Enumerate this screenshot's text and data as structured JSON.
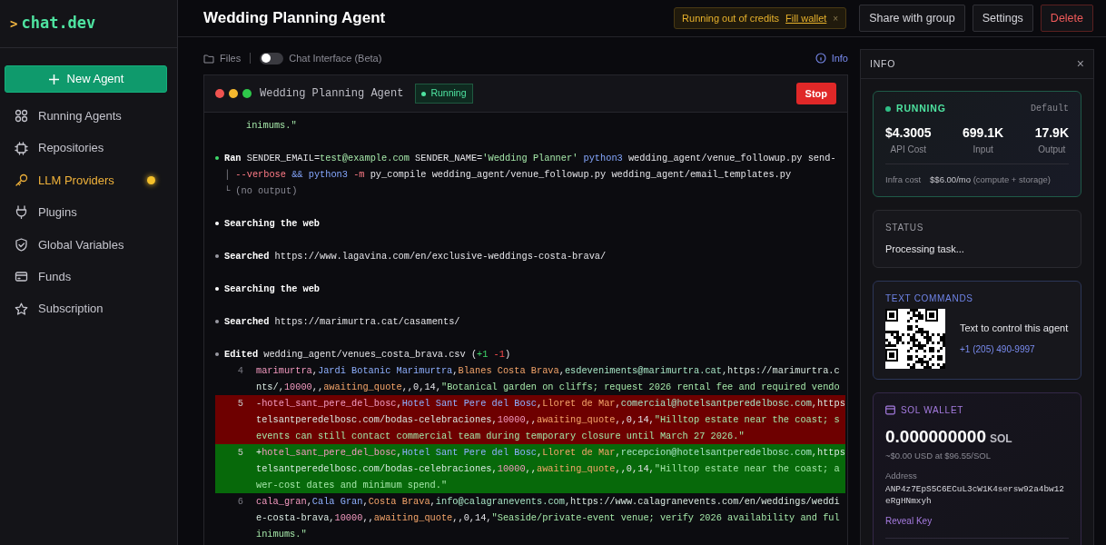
{
  "sidebar": {
    "logo_prompt": ">",
    "logo_text": "chat.dev",
    "new_button": "New Agent",
    "items": [
      {
        "label": "Running Agents",
        "alert": false
      },
      {
        "label": "Repositories",
        "alert": false
      },
      {
        "label": "LLM Providers",
        "alert": true
      },
      {
        "label": "Plugins",
        "alert": false
      },
      {
        "label": "Global Variables",
        "alert": false
      },
      {
        "label": "Funds",
        "alert": false
      },
      {
        "label": "Subscription",
        "alert": false
      }
    ]
  },
  "header": {
    "title": "Wedding Planning Agent",
    "notice": {
      "text": "Running out of credits",
      "link": "Fill wallet",
      "close": "×"
    },
    "buttons": [
      {
        "label": "Share with group",
        "kind": "default"
      },
      {
        "label": "Settings",
        "kind": "default"
      },
      {
        "label": "Delete",
        "kind": "danger"
      }
    ]
  },
  "toolbar": {
    "files": "Files",
    "chat_toggle": {
      "label": "Chat Interface (Beta)",
      "on": false
    },
    "info": "Info"
  },
  "terminal": {
    "title": "Wedding Planning Agent",
    "status": "Running",
    "stop": "Stop",
    "blocks": [
      {
        "kind": "tail",
        "lines": [
          [
            {
              "text": "inimums.\"",
              "kind": "string"
            }
          ]
        ]
      },
      {
        "kind": "step",
        "color": "#3fd96a",
        "lines": [
          [
            {
              "text": "Ran",
              "kind": "bold"
            },
            {
              "text": " SENDER_EMAIL=",
              "kind": "plain"
            },
            {
              "text": "test@example.com",
              "kind": "string"
            },
            {
              "text": " SENDER_NAME=",
              "kind": "plain"
            },
            {
              "text": "'Wedding Planner'",
              "kind": "string"
            },
            {
              "text": " python3",
              "kind": "keyword"
            },
            {
              "text": " wedding_agent/venue_followup.py send-",
              "kind": "plain"
            }
          ],
          [
            {
              "text": "│ ",
              "kind": "muted"
            },
            {
              "text": "--verbose",
              "kind": "flag"
            },
            {
              "text": " && ",
              "kind": "keyword"
            },
            {
              "text": "python3",
              "kind": "keyword"
            },
            {
              "text": " -m",
              "kind": "flag"
            },
            {
              "text": " py_compile wedding_agent/venue_followup.py wedding_agent/email_templates.py",
              "kind": "plain"
            }
          ],
          [
            {
              "text": "└ (no output)",
              "kind": "muted"
            }
          ]
        ]
      },
      {
        "kind": "step",
        "color": "#ffffff",
        "lines": [
          [
            {
              "text": "Searching the web",
              "kind": "bold"
            }
          ]
        ]
      },
      {
        "kind": "step",
        "color": "#9a9aa2",
        "lines": [
          [
            {
              "text": "Searched",
              "kind": "bold"
            },
            {
              "text": " https://www.lagavina.com/en/exclusive-weddings-costa-brava/",
              "kind": "plain"
            }
          ]
        ]
      },
      {
        "kind": "step",
        "color": "#ffffff",
        "lines": [
          [
            {
              "text": "Searching the web",
              "kind": "bold"
            }
          ]
        ]
      },
      {
        "kind": "step",
        "color": "#9a9aa2",
        "lines": [
          [
            {
              "text": "Searched",
              "kind": "bold"
            },
            {
              "text": " https://marimurtra.cat/casaments/",
              "kind": "plain"
            }
          ]
        ]
      },
      {
        "kind": "edit",
        "color": "#9a9aa2",
        "lines": [
          [
            {
              "text": "Edited",
              "kind": "bold"
            },
            {
              "text": " wedding_agent/venues_costa_brava.csv (",
              "kind": "plain"
            },
            {
              "text": "+1",
              "kind": "add"
            },
            {
              "text": " -1",
              "kind": "del"
            },
            {
              "text": ")",
              "kind": "plain"
            }
          ]
        ],
        "diff": [
          {
            "number": "4",
            "kind": "context",
            "lines": [
              [
                {
                  "text": "marimurtra",
                  "kind": "id"
                },
                {
                  "text": ",",
                  "kind": "plain"
                },
                {
                  "text": "Jardi Botanic Marimurtra",
                  "kind": "name"
                },
                {
                  "text": ",",
                  "kind": "plain"
                },
                {
                  "text": "Blanes Costa Brava",
                  "kind": "place"
                },
                {
                  "text": ",",
                  "kind": "plain"
                },
                {
                  "text": "esdeveniments@marimurtra.cat",
                  "kind": "email"
                },
                {
                  "text": ",https://marimurtra.c",
                  "kind": "url"
                }
              ],
              [
                {
                  "text": "nts/,",
                  "kind": "url"
                },
                {
                  "text": "10000",
                  "kind": "number"
                },
                {
                  "text": ",,",
                  "kind": "plain"
                },
                {
                  "text": "awaiting_quote",
                  "kind": "place"
                },
                {
                  "text": ",,0,14,",
                  "kind": "plain"
                },
                {
                  "text": "\"Botanical garden on cliffs; request 2026 rental fee and required vendo",
                  "kind": "string"
                }
              ]
            ]
          },
          {
            "number": "5",
            "kind": "removed",
            "sign": "-",
            "lines": [
              [
                {
                  "text": "hotel_sant_pere_del_bosc",
                  "kind": "id"
                },
                {
                  "text": ",",
                  "kind": "plain"
                },
                {
                  "text": "Hotel Sant Pere del Bosc",
                  "kind": "name"
                },
                {
                  "text": ",",
                  "kind": "plain"
                },
                {
                  "text": "Lloret de Mar",
                  "kind": "place"
                },
                {
                  "text": ",",
                  "kind": "plain"
                },
                {
                  "text": "comercial@hotelsantperedelbosc.com",
                  "kind": "email"
                },
                {
                  "text": ",https",
                  "kind": "url"
                }
              ],
              [
                {
                  "text": "telsantperedelbosc.com/bodas-celebraciones,",
                  "kind": "url"
                },
                {
                  "text": "10000",
                  "kind": "number"
                },
                {
                  "text": ",,",
                  "kind": "plain"
                },
                {
                  "text": "awaiting_quote",
                  "kind": "place"
                },
                {
                  "text": ",,0,14,",
                  "kind": "plain"
                },
                {
                  "text": "\"Hilltop estate near the coast; s",
                  "kind": "string"
                }
              ],
              [
                {
                  "text": "events can still contact commercial team during temporary closure until March 27 2026.\"",
                  "kind": "string"
                }
              ]
            ]
          },
          {
            "number": "5",
            "kind": "added",
            "sign": "+",
            "lines": [
              [
                {
                  "text": "hotel_sant_pere_del_bosc",
                  "kind": "id"
                },
                {
                  "text": ",",
                  "kind": "plain"
                },
                {
                  "text": "Hotel Sant Pere del Bosc",
                  "kind": "name"
                },
                {
                  "text": ",",
                  "kind": "plain"
                },
                {
                  "text": "Lloret de Mar",
                  "kind": "place"
                },
                {
                  "text": ",",
                  "kind": "plain"
                },
                {
                  "text": "recepcion@hotelsantperedelbosc.com",
                  "kind": "email"
                },
                {
                  "text": ",https",
                  "kind": "url"
                }
              ],
              [
                {
                  "text": "telsantperedelbosc.com/bodas-celebraciones,",
                  "kind": "url"
                },
                {
                  "text": "10000",
                  "kind": "number"
                },
                {
                  "text": ",,",
                  "kind": "plain"
                },
                {
                  "text": "awaiting_quote",
                  "kind": "place"
                },
                {
                  "text": ",,0,14,",
                  "kind": "plain"
                },
                {
                  "text": "\"Hilltop estate near the coast; a",
                  "kind": "string"
                }
              ],
              [
                {
                  "text": "wer-cost dates and minimum spend.\"",
                  "kind": "string"
                }
              ]
            ]
          },
          {
            "number": "6",
            "kind": "context",
            "lines": [
              [
                {
                  "text": "cala_gran",
                  "kind": "id"
                },
                {
                  "text": ",",
                  "kind": "plain"
                },
                {
                  "text": "Cala Gran",
                  "kind": "name"
                },
                {
                  "text": ",",
                  "kind": "plain"
                },
                {
                  "text": "Costa Brava",
                  "kind": "place"
                },
                {
                  "text": ",",
                  "kind": "plain"
                },
                {
                  "text": "info@calagranevents.com",
                  "kind": "email"
                },
                {
                  "text": ",https://www.calagranevents.com/en/weddings/weddi",
                  "kind": "url"
                }
              ],
              [
                {
                  "text": "e-costa-brava,",
                  "kind": "url"
                },
                {
                  "text": "10000",
                  "kind": "number"
                },
                {
                  "text": ",,",
                  "kind": "plain"
                },
                {
                  "text": "awaiting_quote",
                  "kind": "place"
                },
                {
                  "text": ",,0,14,",
                  "kind": "plain"
                },
                {
                  "text": "\"Seaside/private-event venue; verify 2026 availability and ful",
                  "kind": "string"
                }
              ],
              [
                {
                  "text": "inimums.\"",
                  "kind": "string"
                }
              ]
            ]
          }
        ]
      }
    ]
  },
  "info_panel": {
    "title": "INFO",
    "close": "×",
    "summary": {
      "state": "RUNNING",
      "tier": "Default",
      "stats": [
        {
          "value": "$4.3005",
          "label": "API Cost"
        },
        {
          "value": "699.1K",
          "label": "Input"
        },
        {
          "value": "17.9K",
          "label": "Output"
        }
      ],
      "infra_label": "Infra cost",
      "infra_value": "$$6.00/mo",
      "infra_note": "(compute + storage)"
    },
    "status": {
      "label": "STATUS",
      "text": "Processing task..."
    },
    "text_commands": {
      "title": "TEXT COMMANDS",
      "text": "Text to control this agent",
      "phone": "+1 (205) 490-9997"
    },
    "wallet": {
      "title": "SOL WALLET",
      "amount": "0.000000000",
      "unit": "SOL",
      "usd": "~$0.00 USD at $96.55/SOL",
      "address_label": "Address",
      "address": "ANP4z7EpS5C6ECuL3cW1K4sersw92a4bw12eRgHNmxyh",
      "reveal": "Reveal Key"
    }
  }
}
